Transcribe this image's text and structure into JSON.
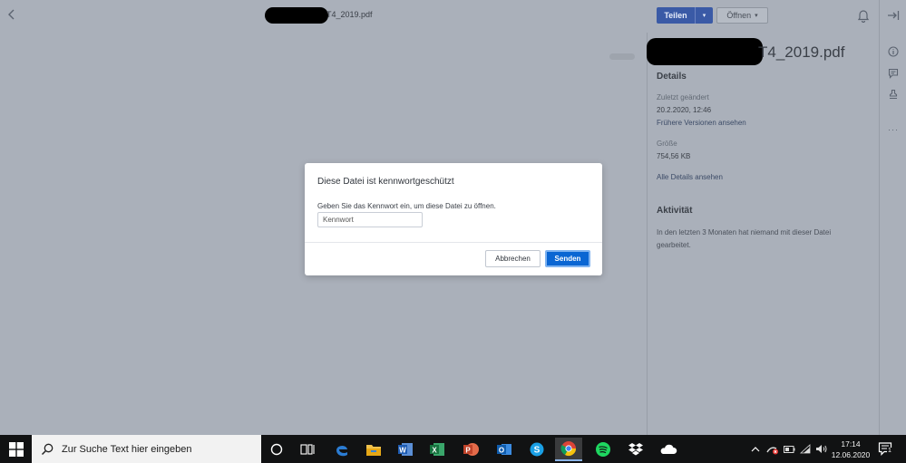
{
  "header": {
    "filename": "T4_2019.pdf",
    "share_label": "Teilen",
    "share_dropdown": "▾",
    "open_label": "Öffnen",
    "open_dropdown": "▾"
  },
  "panel": {
    "filename": "T4_2019.pdf",
    "details_heading": "Details",
    "modified_label": "Zuletzt geändert",
    "modified_value": "20.2.2020, 12:46",
    "versions_link": "Frühere Versionen ansehen",
    "size_label": "Größe",
    "size_value": "754,56 KB",
    "all_details_link": "Alle Details ansehen",
    "activity_heading": "Aktivität",
    "activity_text": "In den letzten 3 Monaten hat niemand mit dieser Datei gearbeitet."
  },
  "modal": {
    "title": "Diese Datei ist kennwortgeschützt",
    "message": "Geben Sie das Kennwort ein, um diese Datei zu öffnen.",
    "password_placeholder": "Kennwort",
    "password_value": "",
    "cancel_label": "Abbrechen",
    "send_label": "Senden"
  },
  "taskbar": {
    "search_placeholder": "Zur Suche Text hier eingeben",
    "time": "17:14",
    "date": "12.06.2020",
    "notification_count": "1",
    "apps": [
      "cortana",
      "task-view",
      "edge",
      "file-explorer",
      "word",
      "excel",
      "powerpoint",
      "outlook",
      "skype",
      "chrome",
      "spotify",
      "dropbox",
      "onedrive"
    ]
  },
  "colors": {
    "overlay": "#aab0ba",
    "accent": "#0a66d3",
    "share_button": "#3a5aa6",
    "taskbar": "#111213"
  }
}
